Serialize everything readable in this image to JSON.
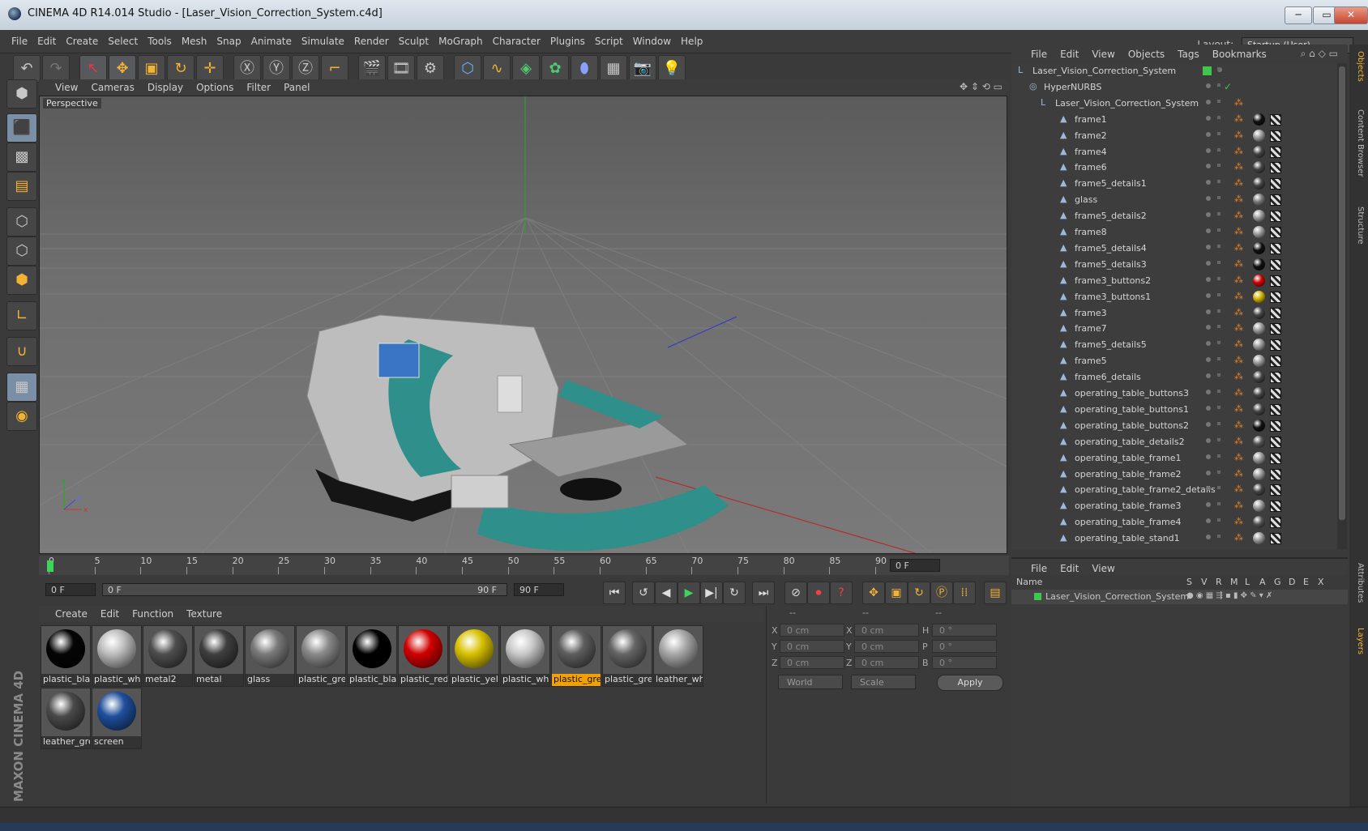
{
  "window": {
    "title": "CINEMA 4D R14.014 Studio - [Laser_Vision_Correction_System.c4d]",
    "buttons": {
      "minimize": "─",
      "maximize": "▭",
      "close": "✕"
    }
  },
  "menubar": {
    "items": [
      "File",
      "Edit",
      "Create",
      "Select",
      "Tools",
      "Mesh",
      "Snap",
      "Animate",
      "Simulate",
      "Render",
      "Sculpt",
      "MoGraph",
      "Character",
      "Plugins",
      "Script",
      "Window",
      "Help"
    ],
    "layout_label": "Layout:",
    "layout_value": "Startup (User)"
  },
  "viewport": {
    "menu": [
      "View",
      "Cameras",
      "Display",
      "Options",
      "Filter",
      "Panel"
    ],
    "label": "Perspective",
    "axis": {
      "x": "x",
      "y": "y",
      "z": "z"
    }
  },
  "timeline": {
    "ticks": [
      "0",
      "5",
      "10",
      "15",
      "20",
      "25",
      "30",
      "35",
      "40",
      "45",
      "50",
      "55",
      "60",
      "65",
      "70",
      "75",
      "80",
      "85",
      "90"
    ],
    "current_frame": "0 F"
  },
  "playbar": {
    "start_field": "0 F",
    "range_start": "0 F",
    "range_end": "90 F",
    "end_field": "90 F"
  },
  "materials": {
    "menu": [
      "Create",
      "Edit",
      "Function",
      "Texture"
    ],
    "items": [
      {
        "label": "plastic_bla",
        "color": "#050505"
      },
      {
        "label": "plastic_whi",
        "color": "#bdbdbd"
      },
      {
        "label": "metal2",
        "color": "#4e4e4e"
      },
      {
        "label": "metal",
        "color": "#3f3f3f"
      },
      {
        "label": "glass",
        "color": "#7a7a7a"
      },
      {
        "label": "plastic_gre",
        "color": "#8a8a8a"
      },
      {
        "label": "plastic_bla",
        "color": "#000000"
      },
      {
        "label": "plastic_red",
        "color": "#d10000"
      },
      {
        "label": "plastic_yell",
        "color": "#d9c200"
      },
      {
        "label": "plastic_whi",
        "color": "#c9c9c9"
      },
      {
        "label": "plastic_gre",
        "color": "#5e5e5e"
      },
      {
        "label": "plastic_gre",
        "color": "#656565"
      },
      {
        "label": "leather_wh",
        "color": "#a8a8a8"
      },
      {
        "label": "leather_gre",
        "color": "#4a4a4a"
      },
      {
        "label": "screen",
        "color": "#1f4f9c"
      }
    ],
    "active_index": 10
  },
  "coordinates": {
    "header": [
      "--",
      "--",
      "--"
    ],
    "rows": [
      {
        "a": "X",
        "av": "0 cm",
        "b": "X",
        "bv": "0 cm",
        "c": "H",
        "cv": "0 °"
      },
      {
        "a": "Y",
        "av": "0 cm",
        "b": "Y",
        "bv": "0 cm",
        "c": "P",
        "cv": "0 °"
      },
      {
        "a": "Z",
        "av": "0 cm",
        "b": "Z",
        "bv": "0 cm",
        "c": "B",
        "cv": "0 °"
      }
    ],
    "mode": "World",
    "scale": "Scale",
    "apply": "Apply"
  },
  "object_manager": {
    "menu": [
      "File",
      "Edit",
      "View",
      "Objects",
      "Tags",
      "Bookmarks"
    ],
    "objects": [
      {
        "name": "Laser_Vision_Correction_System",
        "level": 0,
        "ball": null
      },
      {
        "name": "HyperNURBS",
        "level": 1,
        "ball": null
      },
      {
        "name": "Laser_Vision_Correction_System",
        "level": 2,
        "ball": null
      },
      {
        "name": "frame1",
        "level": 3,
        "ball": "#111111"
      },
      {
        "name": "frame2",
        "level": 3,
        "ball": "#9a9a9a"
      },
      {
        "name": "frame4",
        "level": 3,
        "ball": "#444444"
      },
      {
        "name": "frame6",
        "level": 3,
        "ball": "#444444"
      },
      {
        "name": "frame5_details1",
        "level": 3,
        "ball": "#444444"
      },
      {
        "name": "glass",
        "level": 3,
        "ball": "#7a7a7a"
      },
      {
        "name": "frame5_details2",
        "level": 3,
        "ball": "#9a9a9a"
      },
      {
        "name": "frame8",
        "level": 3,
        "ball": "#9a9a9a"
      },
      {
        "name": "frame5_details4",
        "level": 3,
        "ball": "#111111"
      },
      {
        "name": "frame5_details3",
        "level": 3,
        "ball": "#111111"
      },
      {
        "name": "frame3_buttons2",
        "level": 3,
        "ball": "#cc0000"
      },
      {
        "name": "frame3_buttons1",
        "level": 3,
        "ball": "#d0b400"
      },
      {
        "name": "frame3",
        "level": 3,
        "ball": "#444444"
      },
      {
        "name": "frame7",
        "level": 3,
        "ball": "#9a9a9a"
      },
      {
        "name": "frame5_details5",
        "level": 3,
        "ball": "#9a9a9a"
      },
      {
        "name": "frame5",
        "level": 3,
        "ball": "#9a9a9a"
      },
      {
        "name": "frame6_details",
        "level": 3,
        "ball": "#444444"
      },
      {
        "name": "operating_table_buttons3",
        "level": 3,
        "ball": "#444444"
      },
      {
        "name": "operating_table_buttons1",
        "level": 3,
        "ball": "#444444"
      },
      {
        "name": "operating_table_buttons2",
        "level": 3,
        "ball": "#111111"
      },
      {
        "name": "operating_table_details2",
        "level": 3,
        "ball": "#555555"
      },
      {
        "name": "operating_table_frame1",
        "level": 3,
        "ball": "#9a9a9a"
      },
      {
        "name": "operating_table_frame2",
        "level": 3,
        "ball": "#9a9a9a"
      },
      {
        "name": "operating_table_frame2_details",
        "level": 3,
        "ball": "#444444"
      },
      {
        "name": "operating_table_frame3",
        "level": 3,
        "ball": "#9a9a9a"
      },
      {
        "name": "operating_table_frame4",
        "level": 3,
        "ball": "#555555"
      },
      {
        "name": "operating_table_stand1",
        "level": 3,
        "ball": "#9a9a9a"
      }
    ]
  },
  "layer_manager": {
    "menu": [
      "File",
      "Edit",
      "View"
    ],
    "columns": [
      "Name",
      "S",
      "V",
      "R",
      "M",
      "L",
      "A",
      "G",
      "D",
      "E",
      "X"
    ],
    "row_name": "Laser_Vision_Correction_System"
  },
  "right_tabs": [
    "Objects",
    "Content Browser",
    "Structure",
    "Attributes",
    "Layers"
  ],
  "brand": "MAXON CINEMA 4D"
}
